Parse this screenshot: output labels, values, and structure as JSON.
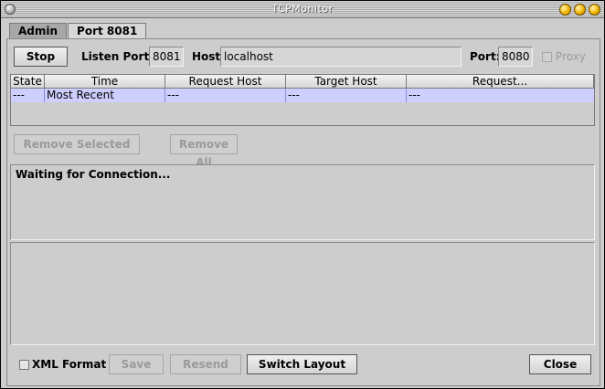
{
  "window": {
    "title": "TCPMonitor"
  },
  "tabs": [
    {
      "label": "Admin"
    },
    {
      "label": "Port 8081"
    }
  ],
  "toolbar": {
    "stop_label": "Stop",
    "listen_port_label": "Listen Port:",
    "listen_port_value": "8081",
    "host_label": "Host:",
    "host_value": "localhost",
    "port_label": "Port:",
    "port_value": "8080",
    "proxy_label": "Proxy",
    "proxy_checked": false
  },
  "table": {
    "columns": [
      "State",
      "Time",
      "Request Host",
      "Target Host",
      "Request..."
    ],
    "rows": [
      [
        "---",
        "Most Recent",
        "---",
        "---",
        "---"
      ]
    ]
  },
  "actions": {
    "remove_selected_label": "Remove Selected",
    "remove_all_label": "Remove All"
  },
  "request_area": {
    "status_text": "Waiting for Connection..."
  },
  "bottom": {
    "xml_format_label": "XML Format",
    "xml_format_checked": false,
    "save_label": "Save",
    "resend_label": "Resend",
    "switch_layout_label": "Switch Layout",
    "close_label": "Close"
  },
  "colors": {
    "selected_row": "#cfcfff",
    "title_text": "#ffffff",
    "window_button": "#f0b400"
  }
}
